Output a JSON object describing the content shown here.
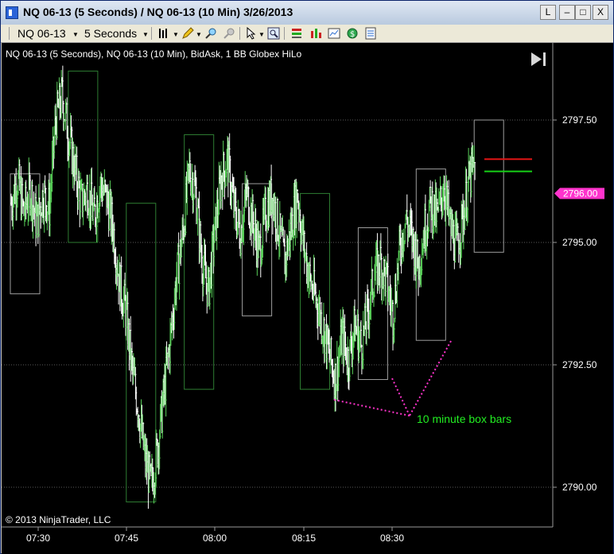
{
  "window": {
    "title": "NQ 06-13 (5 Seconds) / NQ 06-13 (10 Min)  3/26/2013",
    "buttons": [
      "L",
      "–",
      "□",
      "X"
    ]
  },
  "toolbar": {
    "instrument": "NQ 06-13",
    "interval": "5 Seconds",
    "icons": [
      "bar-type-icon",
      "pencil-icon",
      "zoom-in-icon",
      "zoom-out-icon",
      "cursor-icon",
      "magnify-icon",
      "data-box-icon",
      "bar-chart-icon",
      "chart-properties-icon",
      "indicators-icon",
      "strategy-icon"
    ]
  },
  "chart_data": {
    "type": "candlestick",
    "header": "NQ 06-13 (5 Seconds), NQ 06-13 (10 Min), BidAsk, 1 BB Globex HiLo",
    "y_ticks": [
      "2797.50",
      "2795.00",
      "2792.50",
      "2790.00"
    ],
    "y_tick_values": [
      2797.5,
      2795.0,
      2792.5,
      2790.0
    ],
    "ylim": [
      2789.0,
      2799.0
    ],
    "x_ticks": [
      "07:30",
      "07:45",
      "08:00",
      "08:15",
      "08:30"
    ],
    "current_price_label": "2796.00",
    "current_price": 2796.0,
    "grid": true,
    "copyright": "© 2013 NinjaTrader, LLC",
    "annotation": "10 minute box bars",
    "colors": {
      "background": "#000000",
      "up_candle": "#5ad25a",
      "down_candle": "#ffffff",
      "up_box": "#2e7d32",
      "down_box": "#9e9e9e",
      "price_marker": "#ff33cc",
      "hilo_high": "#e01414",
      "hilo_low": "#16d016",
      "annotation": "#22ee22"
    },
    "box_bars": [
      {
        "time": "07:20",
        "open": 2796.4,
        "high": 2796.4,
        "low": 2793.95,
        "close": 2794.1,
        "direction": "down"
      },
      {
        "time": "07:30",
        "open": 2795.0,
        "high": 2798.5,
        "low": 2795.0,
        "close": 2798.5,
        "direction": "up"
      },
      {
        "time": "07:40",
        "open": 2795.8,
        "high": 2795.8,
        "low": 2789.7,
        "close": 2789.7,
        "direction": "up"
      },
      {
        "time": "07:50",
        "open": 2792.0,
        "high": 2797.2,
        "low": 2792.0,
        "close": 2797.2,
        "direction": "up"
      },
      {
        "time": "08:00",
        "open": 2796.2,
        "high": 2796.2,
        "low": 2793.5,
        "close": 2793.5,
        "direction": "down"
      },
      {
        "time": "08:10",
        "open": 2796.0,
        "high": 2796.0,
        "low": 2792.0,
        "close": 2792.0,
        "direction": "up"
      },
      {
        "time": "08:20",
        "open": 2795.3,
        "high": 2795.3,
        "low": 2792.2,
        "close": 2792.2,
        "direction": "down"
      },
      {
        "time": "08:30",
        "open": 2793.0,
        "high": 2796.5,
        "low": 2793.0,
        "close": 2796.5,
        "direction": "down"
      },
      {
        "time": "08:40",
        "open": 2797.5,
        "high": 2797.5,
        "low": 2794.8,
        "close": 2794.8,
        "direction": "down"
      }
    ],
    "hilo": {
      "high": 2796.7,
      "low": 2796.45
    },
    "price_path": [
      2795.8,
      2796.3,
      2795.6,
      2796.1,
      2795.4,
      2796.0,
      2795.7,
      2797.5,
      2798.0,
      2797.2,
      2796.5,
      2795.8,
      2796.1,
      2795.5,
      2796.2,
      2795.9,
      2795.3,
      2794.2,
      2793.6,
      2792.4,
      2791.6,
      2790.6,
      2790.0,
      2790.8,
      2791.9,
      2793.0,
      2794.3,
      2795.2,
      2796.5,
      2796.0,
      2794.6,
      2794.0,
      2795.2,
      2796.3,
      2796.7,
      2795.7,
      2795.2,
      2796.0,
      2795.4,
      2794.8,
      2795.6,
      2796.0,
      2795.3,
      2794.6,
      2795.3,
      2796.0,
      2794.9,
      2794.2,
      2793.8,
      2793.3,
      2792.7,
      2792.2,
      2793.1,
      2792.6,
      2793.3,
      2792.9,
      2793.5,
      2794.3,
      2794.6,
      2794.2,
      2793.5,
      2794.8,
      2795.5,
      2795.1,
      2794.5,
      2795.3,
      2795.8,
      2795.5,
      2796.2,
      2795.3,
      2794.9,
      2795.5,
      2796.3,
      2796.6
    ]
  }
}
